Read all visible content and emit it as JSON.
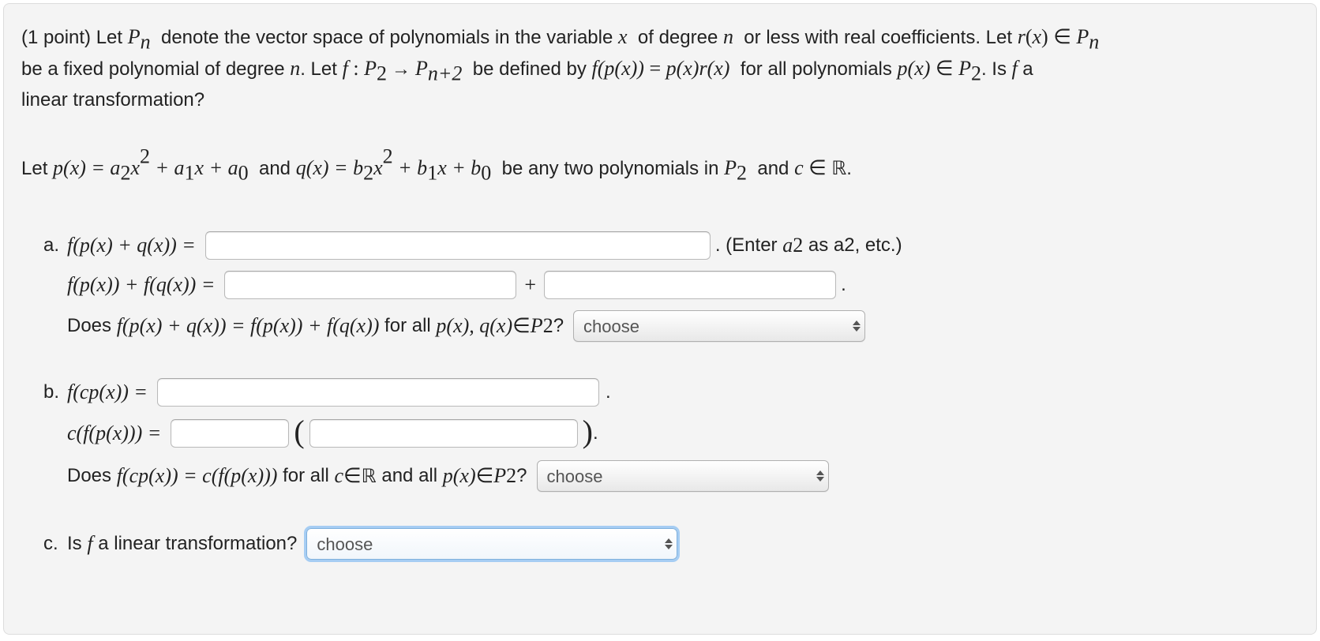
{
  "intro": {
    "t1": "(1 point) Let ",
    "Pn": "P",
    "n1": "n",
    "t2": " denote the vector space of polynomials in the variable ",
    "x": "x",
    "t3": " of degree ",
    "n2": "n",
    "t4": " or less with real coefficients. Let ",
    "rx": "r",
    "lp": "(",
    "x2": "x",
    "rp": ")",
    "in": " ∈ ",
    "Pn2": "P",
    "n3": "n",
    "t5": "be a fixed polynomial of degree ",
    "n4": "n",
    "t6": ". Let ",
    "f": "f",
    "colon": " : ",
    "P2": "P",
    "two": "2",
    "arrow": " → ",
    "Pn2b": "P",
    "np2": "n+2",
    "t7": " be defined by ",
    "f2": "f",
    "fparg": "(p(x))",
    "eq": " = ",
    "px": "p(x)r(x)",
    "t8": " for all polynomials ",
    "px2": "p(x)",
    "in2": " ∈ ",
    "P2b": "P",
    "two2": "2",
    "t9": ". Is",
    "f3": " f ",
    "t10": "a",
    "t11": "linear transformation?"
  },
  "letline": {
    "t1": "Let ",
    "px": "p(x) = a",
    "sub2": "2",
    "x2": "x",
    "sup2a": "2",
    "plus1": " + a",
    "sub1": "1",
    "x1": "x + a",
    "sub0": "0",
    "and": " and ",
    "qx": "q(x) = b",
    "sub2b": "2",
    "x2b": "x",
    "sup2b": "2",
    "plus1b": " + b",
    "sub1b": "1",
    "x1b": "x + b",
    "sub0b": "0",
    "t2": " be any two polynomials in ",
    "P2": "P",
    "two": "2",
    "t3": " and ",
    "c": "c",
    "in": " ∈ ",
    "R": "ℝ",
    "dot": "."
  },
  "a": {
    "marker": "a.",
    "lhs1": "f(p(x) + q(x)) =",
    "after1a": ". (Enter ",
    "a2i": "a",
    "a2s": "2",
    "after1b": " as a2, etc.)",
    "lhs2": "f(p(x)) + f(q(x)) =",
    "plus": "+",
    "dot": ".",
    "q_pre": "Does ",
    "q_math": "f(p(x) + q(x)) = f(p(x)) + f(q(x))",
    "q_mid": " for all ",
    "q_pq": "p(x), q(x)",
    "q_in": " ∈ ",
    "q_P2": "P",
    "q_two": "2",
    "q_qm": "?",
    "choose": "choose"
  },
  "b": {
    "marker": "b.",
    "lhs1": "f(cp(x)) =",
    "dot1": ".",
    "lhs2": "c(f(p(x))) =",
    "dot2": ".",
    "q_pre": "Does ",
    "q_math": "f(cp(x)) = c(f(p(x)))",
    "q_mid1": " for all ",
    "q_c": "c",
    "q_in1": " ∈ ",
    "q_R": "ℝ",
    "q_mid2": " and all ",
    "q_px": "p(x)",
    "q_in2": " ∈ ",
    "q_P2": "P",
    "q_two": "2",
    "q_qm": "?",
    "choose": "choose"
  },
  "c": {
    "marker": "c.",
    "q": "Is ",
    "f": "f",
    "q2": " a linear transformation?",
    "choose": "choose"
  }
}
